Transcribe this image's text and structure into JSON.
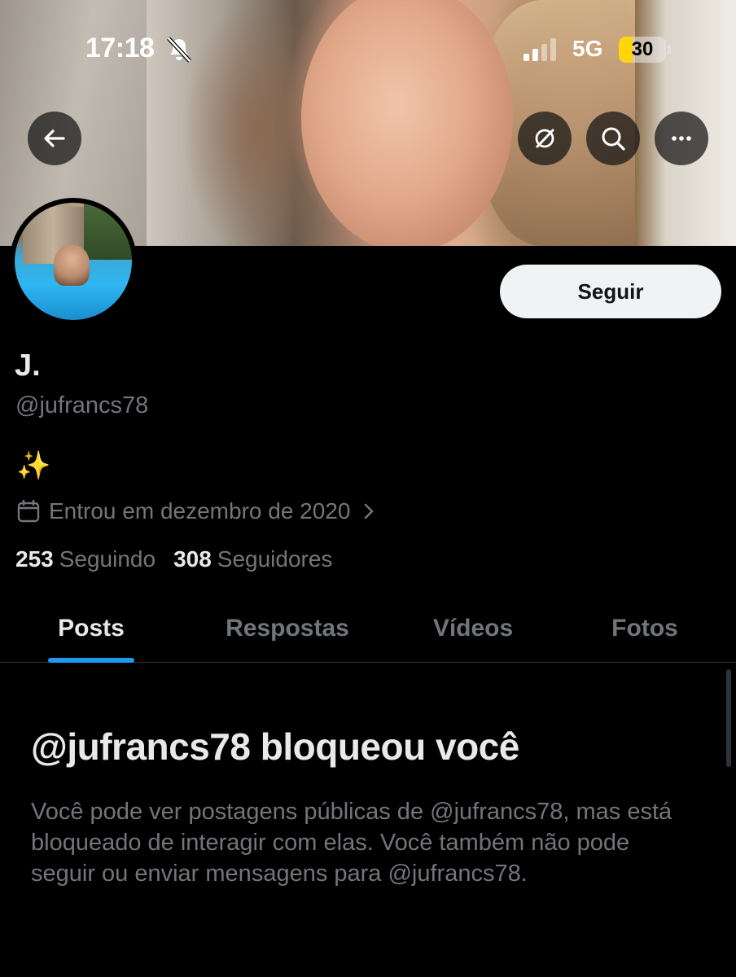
{
  "status_bar": {
    "time": "17:18",
    "network": "5G",
    "battery_percent": "30",
    "battery_level": 0.3,
    "battery_color": "#ffd60a",
    "icons": [
      "bell-slash-icon",
      "signal-icon"
    ]
  },
  "header": {
    "icons": [
      "back-arrow-icon",
      "grok-icon",
      "search-icon",
      "more-icon"
    ]
  },
  "profile": {
    "follow_label": "Seguir",
    "display_name": "J.",
    "handle": "@jufrancs78",
    "bio": "✨",
    "joined": "Entrou em dezembro de 2020",
    "following_count": "253",
    "following_label": "Seguindo",
    "followers_count": "308",
    "followers_label": "Seguidores"
  },
  "tabs": [
    {
      "label": "Posts",
      "active": true
    },
    {
      "label": "Respostas",
      "active": false
    },
    {
      "label": "Vídeos",
      "active": false
    },
    {
      "label": "Fotos",
      "active": false
    }
  ],
  "blocked": {
    "title": "@jufrancs78 bloqueou você",
    "body": "Você pode ver postagens públicas de @jufrancs78, mas está bloqueado de interagir com elas. Você também não pode seguir ou enviar mensagens para @jufrancs78."
  },
  "colors": {
    "accent": "#1d9bf0",
    "background": "#000000",
    "text_primary": "#e7e9ea",
    "text_secondary": "#71767b"
  }
}
